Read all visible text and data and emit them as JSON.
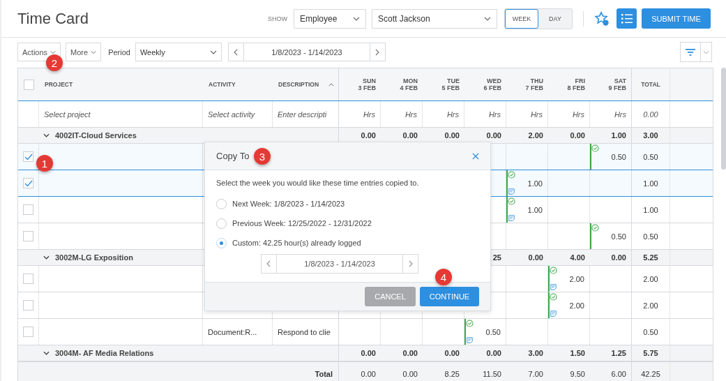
{
  "header": {
    "title": "Time Card",
    "show_label": "SHOW",
    "show_select": "Employee",
    "employee_select": "Scott Jackson",
    "view_toggle": [
      {
        "label": "WEEK",
        "selected": true
      },
      {
        "label": "DAY",
        "selected": false
      }
    ],
    "submit_button": "SUBMIT TIME"
  },
  "toolbar": {
    "actions_button": "Actions",
    "more_button": "More",
    "period_label": "Period",
    "period_select": "Weekly",
    "date_range": "1/8/2023 - 1/14/2023"
  },
  "table": {
    "columns": {
      "project": "PROJECT",
      "activity": "ACTIVITY",
      "description": "DESCRIPTION",
      "total": "TOTAL",
      "days": [
        {
          "day": "SUN",
          "date": "3 FEB"
        },
        {
          "day": "MON",
          "date": "4 FEB"
        },
        {
          "day": "TUE",
          "date": "5 FEB"
        },
        {
          "day": "WED",
          "date": "6 FEB"
        },
        {
          "day": "THU",
          "date": "7 FEB"
        },
        {
          "day": "FRI",
          "date": "8 FEB"
        },
        {
          "day": "SAT",
          "date": "9 FEB"
        }
      ]
    },
    "all_checked": false,
    "new_entry": {
      "project": "Select project",
      "activity": "Select activity",
      "description": "Enter descripti",
      "hours": [
        "Hrs",
        "Hrs",
        "Hrs",
        "Hrs",
        "Hrs",
        "Hrs",
        "Hrs"
      ],
      "total": "0.00"
    },
    "groups": [
      {
        "name": "4002IT-Cloud Services",
        "expanded": true,
        "hours": {
          "sun": "0.00",
          "mon": "0.00",
          "tue": "0.00",
          "wed": "0.00",
          "thu": "2.00",
          "fri": "0.00",
          "sat": "1.00"
        },
        "total": "3.00",
        "rows": [
          {
            "checked": true,
            "hours": {
              "sat": {
                "value": "0.50",
                "approved": true,
                "note": false
              }
            },
            "total": "0.50"
          },
          {
            "checked": true,
            "hours": {
              "thu": {
                "value": "1.00",
                "approved": true,
                "note": true
              }
            },
            "total": "1.00"
          },
          {
            "checked": false,
            "hours": {
              "thu": {
                "value": "1.00",
                "approved": true,
                "note": true
              }
            },
            "total": "1.00"
          },
          {
            "checked": false,
            "hours": {
              "sat": {
                "value": "0.50",
                "approved": true,
                "note": false
              }
            },
            "total": "0.50"
          }
        ]
      },
      {
        "name": "3002M-LG Exposition",
        "expanded": true,
        "hours": {
          "wed": "25",
          "thu": "0.00",
          "fri": "4.00",
          "sat": "0.00"
        },
        "total": "5.25",
        "rows": [
          {
            "checked": false,
            "hours": {
              "fri": {
                "value": "2.00",
                "approved": true,
                "note": true
              }
            },
            "total": "2.00"
          },
          {
            "checked": false,
            "hours": {
              "fri": {
                "value": "2.00",
                "approved": true,
                "note": true
              }
            },
            "total": "2.00"
          },
          {
            "checked": false,
            "activity": "Document:R...",
            "description": "Respond to clie",
            "hours": {
              "wed": {
                "value": "0.50",
                "approved": true,
                "note": true
              }
            },
            "total": "0.50"
          }
        ]
      },
      {
        "name": "3004M- AF Media Relations",
        "expanded": true,
        "hours": {
          "sun": "0.00",
          "mon": "0.00",
          "tue": "0.00",
          "wed": "0.00",
          "thu": "3.00",
          "fri": "1.50",
          "sat": "1.25"
        },
        "total": "5.75"
      }
    ],
    "totals": {
      "label": "Total",
      "hours": [
        "0.00",
        "0.00",
        "8.25",
        "11.50",
        "7.00",
        "9.50",
        "6.00"
      ],
      "total": "42.25"
    }
  },
  "dialog": {
    "title": "Copy To",
    "message": "Select the week you would like these time entries copied to.",
    "options": [
      {
        "label": "Next Week: 1/8/2023 - 1/14/2023",
        "selected": false
      },
      {
        "label": "Previous Week: 12/25/2022 - 12/31/2022",
        "selected": false
      },
      {
        "label": "Custom: 42.25 hour(s) already logged",
        "selected": true
      }
    ],
    "date_range": "1/8/2023 - 1/14/2023",
    "cancel_button": "CANCEL",
    "continue_button": "CONTINUE"
  },
  "badges": [
    "1",
    "2",
    "3",
    "4"
  ]
}
